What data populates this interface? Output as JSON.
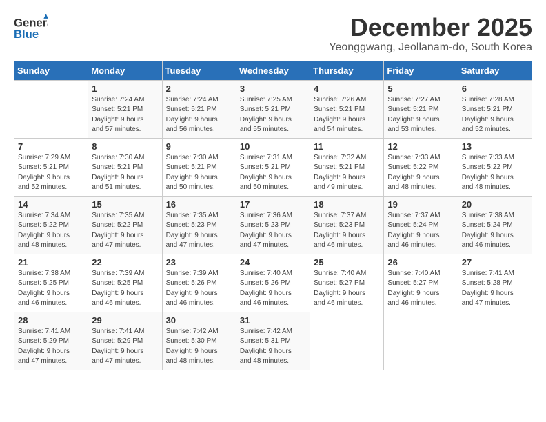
{
  "logo": {
    "line1": "General",
    "line2": "Blue"
  },
  "title": "December 2025",
  "subtitle": "Yeonggwang, Jeollanam-do, South Korea",
  "days_of_week": [
    "Sunday",
    "Monday",
    "Tuesday",
    "Wednesday",
    "Thursday",
    "Friday",
    "Saturday"
  ],
  "weeks": [
    [
      {
        "day": "",
        "info": ""
      },
      {
        "day": "1",
        "info": "Sunrise: 7:24 AM\nSunset: 5:21 PM\nDaylight: 9 hours\nand 57 minutes."
      },
      {
        "day": "2",
        "info": "Sunrise: 7:24 AM\nSunset: 5:21 PM\nDaylight: 9 hours\nand 56 minutes."
      },
      {
        "day": "3",
        "info": "Sunrise: 7:25 AM\nSunset: 5:21 PM\nDaylight: 9 hours\nand 55 minutes."
      },
      {
        "day": "4",
        "info": "Sunrise: 7:26 AM\nSunset: 5:21 PM\nDaylight: 9 hours\nand 54 minutes."
      },
      {
        "day": "5",
        "info": "Sunrise: 7:27 AM\nSunset: 5:21 PM\nDaylight: 9 hours\nand 53 minutes."
      },
      {
        "day": "6",
        "info": "Sunrise: 7:28 AM\nSunset: 5:21 PM\nDaylight: 9 hours\nand 52 minutes."
      }
    ],
    [
      {
        "day": "7",
        "info": "Sunrise: 7:29 AM\nSunset: 5:21 PM\nDaylight: 9 hours\nand 52 minutes."
      },
      {
        "day": "8",
        "info": "Sunrise: 7:30 AM\nSunset: 5:21 PM\nDaylight: 9 hours\nand 51 minutes."
      },
      {
        "day": "9",
        "info": "Sunrise: 7:30 AM\nSunset: 5:21 PM\nDaylight: 9 hours\nand 50 minutes."
      },
      {
        "day": "10",
        "info": "Sunrise: 7:31 AM\nSunset: 5:21 PM\nDaylight: 9 hours\nand 50 minutes."
      },
      {
        "day": "11",
        "info": "Sunrise: 7:32 AM\nSunset: 5:21 PM\nDaylight: 9 hours\nand 49 minutes."
      },
      {
        "day": "12",
        "info": "Sunrise: 7:33 AM\nSunset: 5:22 PM\nDaylight: 9 hours\nand 48 minutes."
      },
      {
        "day": "13",
        "info": "Sunrise: 7:33 AM\nSunset: 5:22 PM\nDaylight: 9 hours\nand 48 minutes."
      }
    ],
    [
      {
        "day": "14",
        "info": "Sunrise: 7:34 AM\nSunset: 5:22 PM\nDaylight: 9 hours\nand 48 minutes."
      },
      {
        "day": "15",
        "info": "Sunrise: 7:35 AM\nSunset: 5:22 PM\nDaylight: 9 hours\nand 47 minutes."
      },
      {
        "day": "16",
        "info": "Sunrise: 7:35 AM\nSunset: 5:23 PM\nDaylight: 9 hours\nand 47 minutes."
      },
      {
        "day": "17",
        "info": "Sunrise: 7:36 AM\nSunset: 5:23 PM\nDaylight: 9 hours\nand 47 minutes."
      },
      {
        "day": "18",
        "info": "Sunrise: 7:37 AM\nSunset: 5:23 PM\nDaylight: 9 hours\nand 46 minutes."
      },
      {
        "day": "19",
        "info": "Sunrise: 7:37 AM\nSunset: 5:24 PM\nDaylight: 9 hours\nand 46 minutes."
      },
      {
        "day": "20",
        "info": "Sunrise: 7:38 AM\nSunset: 5:24 PM\nDaylight: 9 hours\nand 46 minutes."
      }
    ],
    [
      {
        "day": "21",
        "info": "Sunrise: 7:38 AM\nSunset: 5:25 PM\nDaylight: 9 hours\nand 46 minutes."
      },
      {
        "day": "22",
        "info": "Sunrise: 7:39 AM\nSunset: 5:25 PM\nDaylight: 9 hours\nand 46 minutes."
      },
      {
        "day": "23",
        "info": "Sunrise: 7:39 AM\nSunset: 5:26 PM\nDaylight: 9 hours\nand 46 minutes."
      },
      {
        "day": "24",
        "info": "Sunrise: 7:40 AM\nSunset: 5:26 PM\nDaylight: 9 hours\nand 46 minutes."
      },
      {
        "day": "25",
        "info": "Sunrise: 7:40 AM\nSunset: 5:27 PM\nDaylight: 9 hours\nand 46 minutes."
      },
      {
        "day": "26",
        "info": "Sunrise: 7:40 AM\nSunset: 5:27 PM\nDaylight: 9 hours\nand 46 minutes."
      },
      {
        "day": "27",
        "info": "Sunrise: 7:41 AM\nSunset: 5:28 PM\nDaylight: 9 hours\nand 47 minutes."
      }
    ],
    [
      {
        "day": "28",
        "info": "Sunrise: 7:41 AM\nSunset: 5:29 PM\nDaylight: 9 hours\nand 47 minutes."
      },
      {
        "day": "29",
        "info": "Sunrise: 7:41 AM\nSunset: 5:29 PM\nDaylight: 9 hours\nand 47 minutes."
      },
      {
        "day": "30",
        "info": "Sunrise: 7:42 AM\nSunset: 5:30 PM\nDaylight: 9 hours\nand 48 minutes."
      },
      {
        "day": "31",
        "info": "Sunrise: 7:42 AM\nSunset: 5:31 PM\nDaylight: 9 hours\nand 48 minutes."
      },
      {
        "day": "",
        "info": ""
      },
      {
        "day": "",
        "info": ""
      },
      {
        "day": "",
        "info": ""
      }
    ]
  ]
}
